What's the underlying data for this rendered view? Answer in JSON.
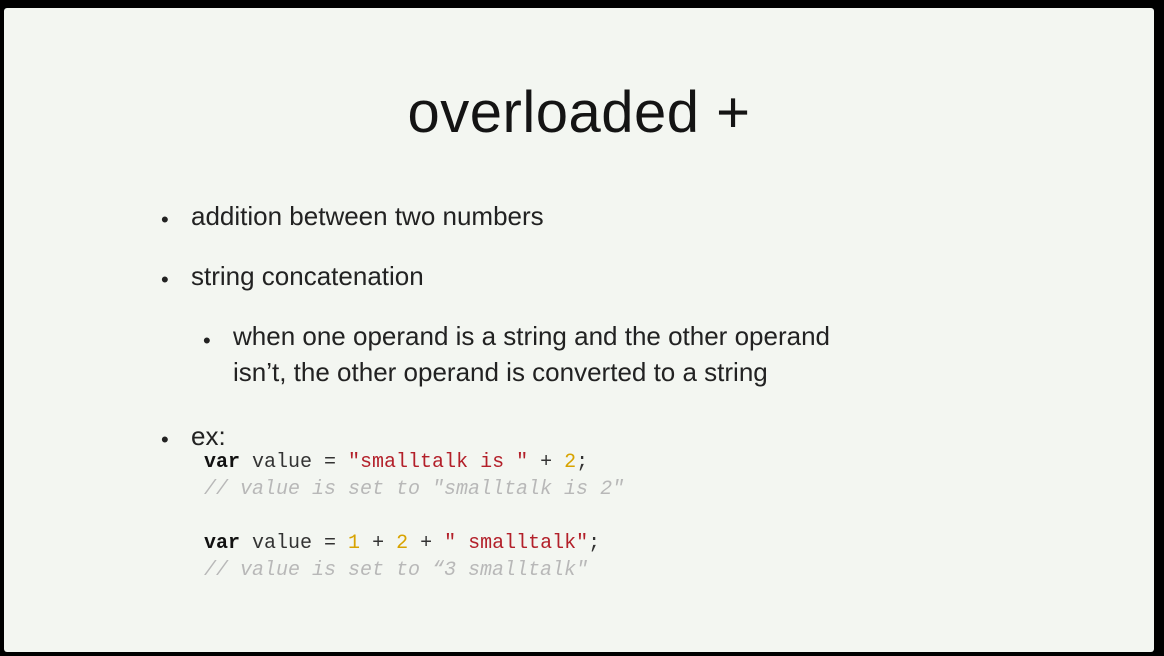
{
  "slide": {
    "title": "overloaded +",
    "bullets": [
      {
        "text": "addition between two numbers"
      },
      {
        "text": "string concatenation"
      },
      {
        "text_line1": "when one operand is a string and the other operand",
        "text_line2": "isn’t, the other operand is converted to a string"
      },
      {
        "text": "ex:"
      }
    ],
    "bullet_symbol": "•",
    "code": {
      "line1": {
        "kw": "var",
        "ident": " value = ",
        "str": "\"smalltalk is \"",
        "op": " + ",
        "num": "2",
        "end": ";"
      },
      "line2": {
        "comment": "// value is set to \"smalltalk is 2\""
      },
      "line3": {
        "kw": "var",
        "ident": " value = ",
        "num1": "1",
        "op1": " + ",
        "num2": "2",
        "op2": " + ",
        "str": "\" smalltalk\"",
        "end": ";"
      },
      "line4": {
        "comment": "// value is set to “3 smalltalk\""
      }
    }
  }
}
